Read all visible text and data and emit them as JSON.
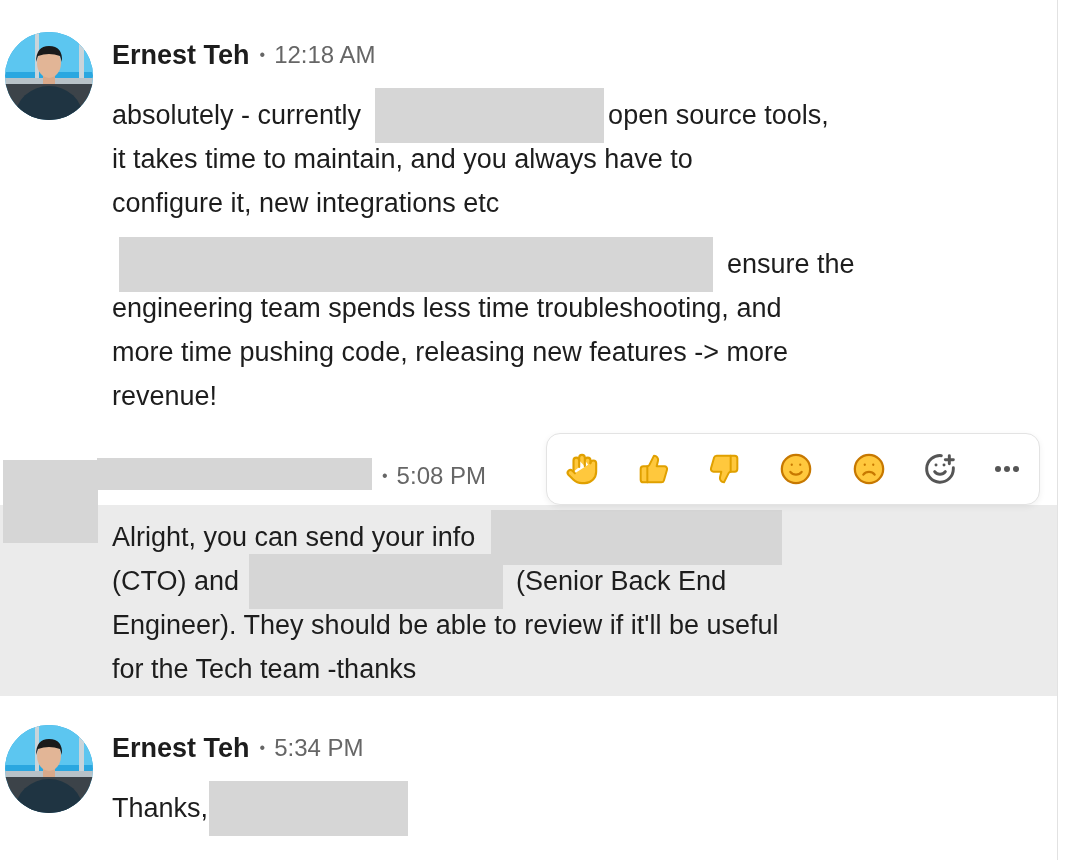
{
  "messages": [
    {
      "avatar": {
        "kind": "picture"
      },
      "author": {
        "kind": "name",
        "text": "Ernest Teh"
      },
      "separator": "•",
      "time": "12:18 AM",
      "highlighted": false,
      "paragraphs": [
        {
          "lines": [
            [
              {
                "kind": "text",
                "text": "absolutely - currently"
              },
              {
                "kind": "redacted"
              },
              {
                "kind": "text",
                "text": "open source tools,"
              }
            ],
            [
              {
                "kind": "text",
                "text": "it takes time to maintain, and you always have to"
              }
            ],
            [
              {
                "kind": "text",
                "text": "configure it, new integrations etc"
              }
            ]
          ]
        },
        {
          "lines": [
            [
              {
                "kind": "redacted"
              },
              {
                "kind": "text",
                "text": "ensure the"
              }
            ],
            [
              {
                "kind": "text",
                "text": "engineering team spends less time troubleshooting, and"
              }
            ],
            [
              {
                "kind": "text",
                "text": "more time pushing code, releasing new features -> more"
              }
            ],
            [
              {
                "kind": "text",
                "text": "revenue!"
              }
            ]
          ]
        }
      ]
    },
    {
      "avatar": {
        "kind": "redacted"
      },
      "author": {
        "kind": "redacted"
      },
      "separator": "•",
      "time": "5:08 PM",
      "highlighted": true,
      "reaction_bar": {
        "items": [
          {
            "kind": "clap"
          },
          {
            "kind": "thumbs_up"
          },
          {
            "kind": "thumbs_down"
          },
          {
            "kind": "smile"
          },
          {
            "kind": "sad"
          },
          {
            "kind": "add_reaction"
          },
          {
            "kind": "more"
          }
        ]
      },
      "paragraphs": [
        {
          "lines": [
            [
              {
                "kind": "text",
                "text": "Alright, you can send your info"
              },
              {
                "kind": "redacted"
              }
            ],
            [
              {
                "kind": "text",
                "text": "(CTO) and"
              },
              {
                "kind": "redacted"
              },
              {
                "kind": "text",
                "text": "(Senior Back End"
              }
            ],
            [
              {
                "kind": "text",
                "text": "Engineer). They should be able to review if it'll be useful"
              }
            ],
            [
              {
                "kind": "text",
                "text": "for the Tech team -thanks"
              }
            ]
          ]
        }
      ]
    },
    {
      "avatar": {
        "kind": "picture"
      },
      "author": {
        "kind": "name",
        "text": "Ernest Teh"
      },
      "separator": "•",
      "time": "5:34 PM",
      "highlighted": false,
      "paragraphs": [
        {
          "lines": [
            [
              {
                "kind": "text",
                "text": "Thanks,"
              },
              {
                "kind": "redacted"
              }
            ]
          ]
        }
      ]
    }
  ]
}
